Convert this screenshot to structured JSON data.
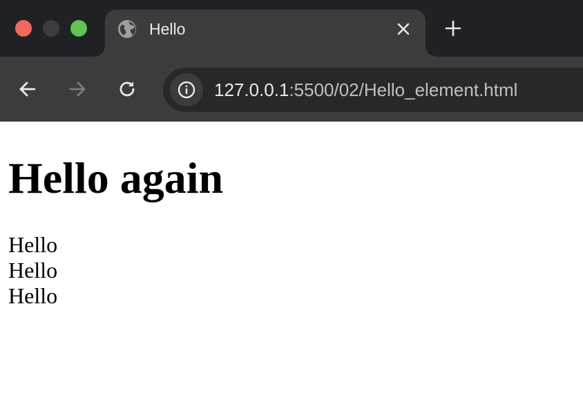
{
  "window": {
    "traffic_lights": {
      "close_color": "#ee6a5f",
      "minimize_color": "#3c3c3e",
      "maximize_color": "#5fc454"
    }
  },
  "tabs": [
    {
      "title": "Hello",
      "favicon": "globe-icon",
      "active": true,
      "close_icon": "close-icon"
    }
  ],
  "new_tab_icon": "plus-icon",
  "toolbar": {
    "back_icon": "arrow-left-icon",
    "forward_icon": "arrow-right-icon",
    "forward_enabled": false,
    "reload_icon": "reload-icon",
    "site_info_icon": "info-icon",
    "url_host": "127.0.0.1",
    "url_rest": ":5500/02/Hello_element.html"
  },
  "page": {
    "heading": "Hello again",
    "lines": [
      "Hello",
      "Hello",
      "Hello"
    ]
  },
  "colors": {
    "tabstrip_bg": "#202124",
    "toolbar_bg": "#3c3c3c",
    "omnibox_bg": "#282828",
    "page_bg": "#ffffff"
  }
}
